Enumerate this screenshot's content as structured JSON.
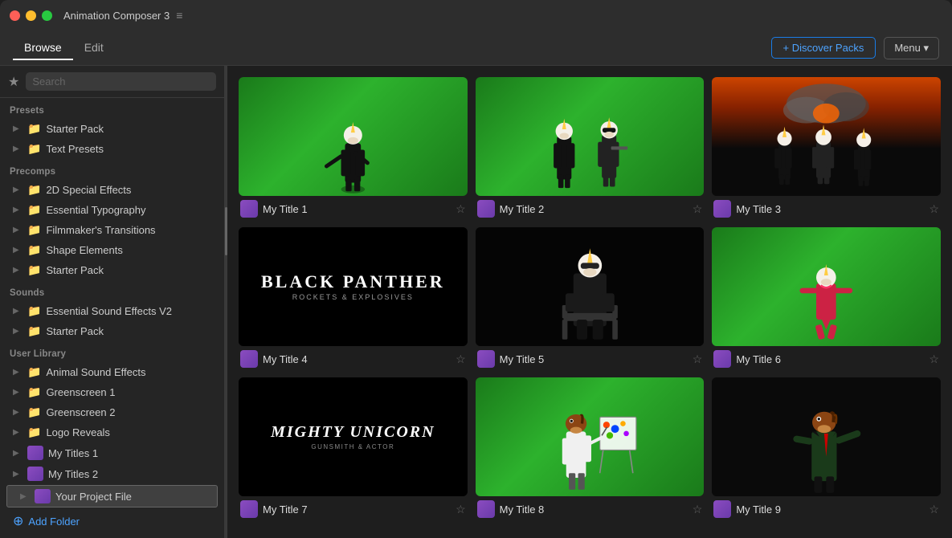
{
  "titleBar": {
    "title": "Animation Composer 3",
    "menuIcon": "≡"
  },
  "navBar": {
    "tabs": [
      {
        "label": "Browse",
        "active": true
      },
      {
        "label": "Edit",
        "active": false
      }
    ],
    "discoverButton": "+ Discover Packs",
    "menuButton": "Menu ▾"
  },
  "sidebar": {
    "searchPlaceholder": "Search",
    "sections": [
      {
        "header": "Presets",
        "items": [
          {
            "type": "folder",
            "label": "Starter Pack",
            "chevron": true
          },
          {
            "type": "folder",
            "label": "Text Presets",
            "chevron": true
          }
        ]
      },
      {
        "header": "Precomps",
        "items": [
          {
            "type": "folder",
            "label": "2D Special Effects",
            "chevron": true
          },
          {
            "type": "folder",
            "label": "Essential Typography",
            "chevron": true
          },
          {
            "type": "folder",
            "label": "Filmmaker's Transitions",
            "chevron": true
          },
          {
            "type": "folder",
            "label": "Shape Elements",
            "chevron": true
          },
          {
            "type": "folder",
            "label": "Starter Pack",
            "chevron": true
          }
        ]
      },
      {
        "header": "Sounds",
        "items": [
          {
            "type": "folder",
            "label": "Essential Sound Effects V2",
            "chevron": true
          },
          {
            "type": "folder",
            "label": "Starter Pack",
            "chevron": true
          }
        ]
      },
      {
        "header": "User Library",
        "items": [
          {
            "type": "folder",
            "label": "Animal Sound Effects",
            "chevron": true
          },
          {
            "type": "folder",
            "label": "Greenscreen 1",
            "chevron": true
          },
          {
            "type": "folder",
            "label": "Greenscreen 2",
            "chevron": true
          },
          {
            "type": "folder",
            "label": "Logo Reveals",
            "chevron": true
          },
          {
            "type": "preset",
            "label": "My Titles 1",
            "chevron": true
          },
          {
            "type": "preset",
            "label": "My Titles 2",
            "chevron": true
          },
          {
            "type": "preset",
            "label": "Your Project File",
            "chevron": true,
            "active": true
          }
        ]
      }
    ],
    "addFolder": "Add Folder"
  },
  "grid": {
    "items": [
      {
        "id": 1,
        "title": "My Title 1",
        "type": "green-single"
      },
      {
        "id": 2,
        "title": "My Title 2",
        "type": "green-double"
      },
      {
        "id": 3,
        "title": "My Title 3",
        "type": "explosion-triple"
      },
      {
        "id": 4,
        "title": "My Title 4",
        "type": "black-panther"
      },
      {
        "id": 5,
        "title": "My Title 5",
        "type": "dark-seated"
      },
      {
        "id": 6,
        "title": "My Title 6",
        "type": "green-dance"
      },
      {
        "id": 7,
        "title": "My Title 7",
        "type": "mighty-unicorn"
      },
      {
        "id": 8,
        "title": "My Title 8",
        "type": "green-painter"
      },
      {
        "id": 9,
        "title": "My Title 9",
        "type": "dark-presenter"
      }
    ]
  },
  "colors": {
    "accent": "#4da3ff",
    "bg": "#1e1e1e",
    "sidebar": "#252525",
    "green": "#2db22d"
  }
}
